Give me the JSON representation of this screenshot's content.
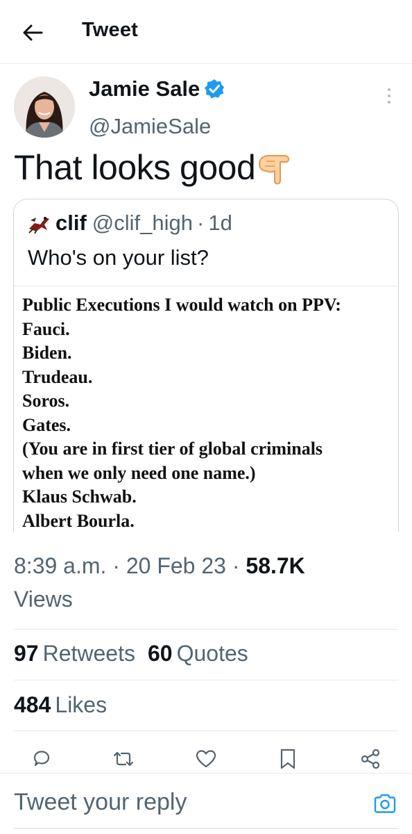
{
  "header": {
    "title": "Tweet",
    "back_icon": "arrow-left-icon"
  },
  "tweet": {
    "author": {
      "name": "Jamie Sale",
      "handle": "@JamieSale",
      "verified": true,
      "verified_color": "#1d9bf0"
    },
    "text": "That looks good",
    "emoji_icon": "pointing-down-hand-icon",
    "quote": {
      "name": "clif",
      "handle": "@clif_high",
      "separator": "·",
      "time": "1d",
      "text": "Who's on your list?",
      "image_lines": [
        "Public Executions I would watch on PPV:",
        "Fauci.",
        "Biden.",
        "Trudeau.",
        "Soros.",
        "Gates.",
        "(You are in first tier of global criminals",
        "when we only need one name.)",
        "Klaus Schwab.",
        "Albert Bourla."
      ]
    },
    "meta": {
      "time": "8:39 a.m.",
      "sep1": "·",
      "date": "20 Feb 23",
      "sep2": "·",
      "views_count": "58.7K",
      "views_label": "Views"
    },
    "stats": {
      "retweets_count": "97",
      "retweets_label": "Retweets",
      "quotes_count": "60",
      "quotes_label": "Quotes",
      "likes_count": "484",
      "likes_label": "Likes"
    }
  },
  "actions": [
    "reply-icon",
    "retweet-icon",
    "like-icon",
    "bookmark-icon",
    "share-icon"
  ],
  "reply": {
    "placeholder": "Tweet your reply",
    "camera_icon": "camera-icon"
  },
  "colors": {
    "text": "#0f1419",
    "secondary": "#536471",
    "accent": "#1d9bf0",
    "border": "#e6e9ec"
  }
}
